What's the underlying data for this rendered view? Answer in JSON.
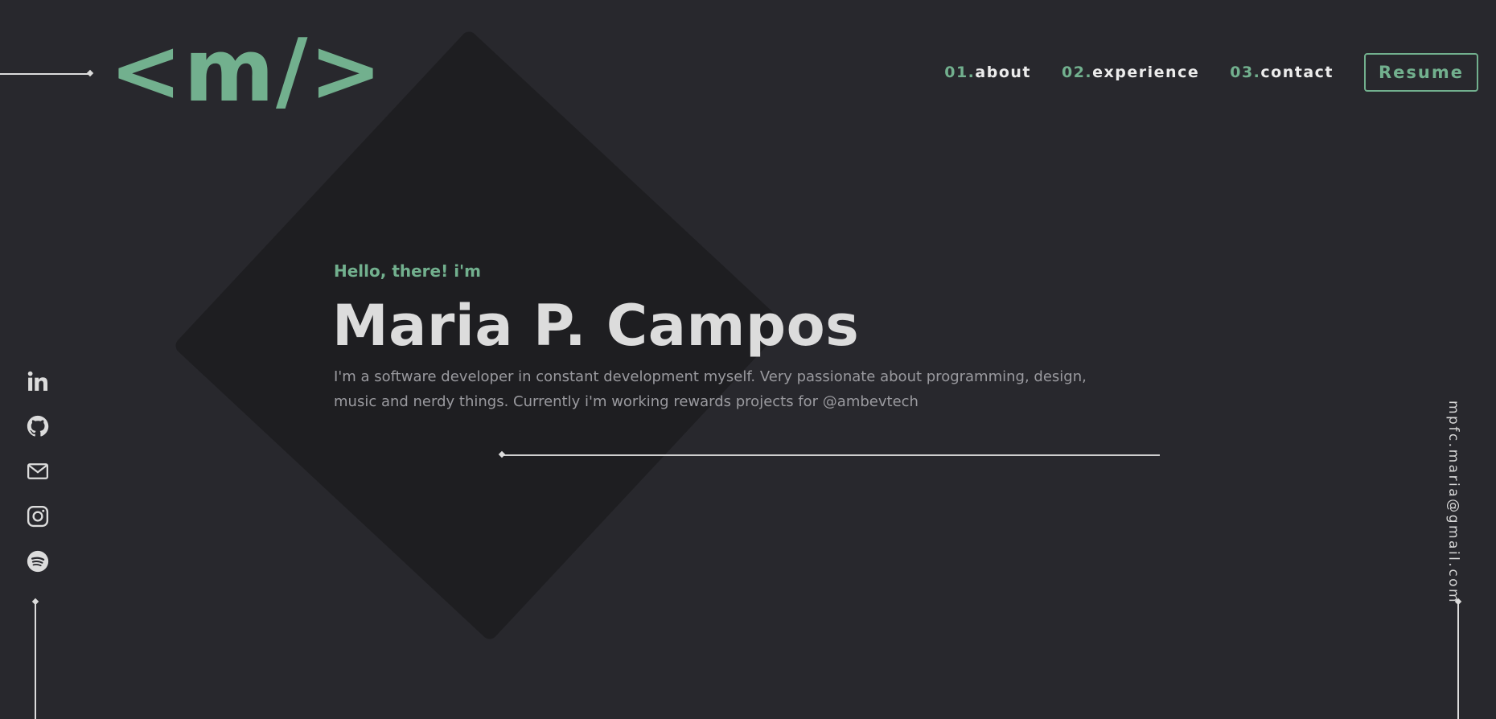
{
  "logo": {
    "text": "<m/>"
  },
  "nav": {
    "items": [
      {
        "num": "01.",
        "label": "about"
      },
      {
        "num": "02.",
        "label": "experience"
      },
      {
        "num": "03.",
        "label": "contact"
      }
    ],
    "resume_label": "Resume"
  },
  "hero": {
    "greeting": "Hello, there! i'm",
    "name": "Maria P. Campos",
    "bio": "I'm a software developer in constant development myself. Very passionate about programming, design, music and nerdy things. Currently i'm working rewards projects for @ambevtech"
  },
  "socials": [
    {
      "icon": "linkedin-icon"
    },
    {
      "icon": "github-icon"
    },
    {
      "icon": "mail-icon"
    },
    {
      "icon": "instagram-icon"
    },
    {
      "icon": "spotify-icon"
    }
  ],
  "email": "mpfc.maria@gmail.com",
  "colors": {
    "background": "#28282d",
    "accent": "#72b08e",
    "shape": "#1e1e21",
    "text": "#dcdcdc",
    "muted": "#9a9a9f"
  }
}
